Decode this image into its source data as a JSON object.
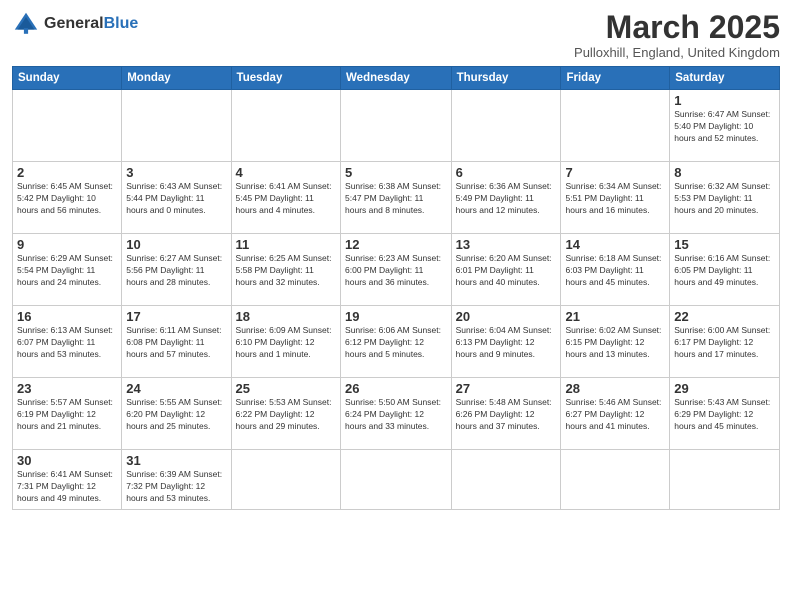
{
  "header": {
    "logo_general": "General",
    "logo_blue": "Blue",
    "month_title": "March 2025",
    "subtitle": "Pulloxhill, England, United Kingdom"
  },
  "days_of_week": [
    "Sunday",
    "Monday",
    "Tuesday",
    "Wednesday",
    "Thursday",
    "Friday",
    "Saturday"
  ],
  "weeks": [
    [
      {
        "day": "",
        "info": ""
      },
      {
        "day": "",
        "info": ""
      },
      {
        "day": "",
        "info": ""
      },
      {
        "day": "",
        "info": ""
      },
      {
        "day": "",
        "info": ""
      },
      {
        "day": "",
        "info": ""
      },
      {
        "day": "1",
        "info": "Sunrise: 6:47 AM\nSunset: 5:40 PM\nDaylight: 10 hours and 52 minutes."
      }
    ],
    [
      {
        "day": "2",
        "info": "Sunrise: 6:45 AM\nSunset: 5:42 PM\nDaylight: 10 hours and 56 minutes."
      },
      {
        "day": "3",
        "info": "Sunrise: 6:43 AM\nSunset: 5:44 PM\nDaylight: 11 hours and 0 minutes."
      },
      {
        "day": "4",
        "info": "Sunrise: 6:41 AM\nSunset: 5:45 PM\nDaylight: 11 hours and 4 minutes."
      },
      {
        "day": "5",
        "info": "Sunrise: 6:38 AM\nSunset: 5:47 PM\nDaylight: 11 hours and 8 minutes."
      },
      {
        "day": "6",
        "info": "Sunrise: 6:36 AM\nSunset: 5:49 PM\nDaylight: 11 hours and 12 minutes."
      },
      {
        "day": "7",
        "info": "Sunrise: 6:34 AM\nSunset: 5:51 PM\nDaylight: 11 hours and 16 minutes."
      },
      {
        "day": "8",
        "info": "Sunrise: 6:32 AM\nSunset: 5:53 PM\nDaylight: 11 hours and 20 minutes."
      }
    ],
    [
      {
        "day": "9",
        "info": "Sunrise: 6:29 AM\nSunset: 5:54 PM\nDaylight: 11 hours and 24 minutes."
      },
      {
        "day": "10",
        "info": "Sunrise: 6:27 AM\nSunset: 5:56 PM\nDaylight: 11 hours and 28 minutes."
      },
      {
        "day": "11",
        "info": "Sunrise: 6:25 AM\nSunset: 5:58 PM\nDaylight: 11 hours and 32 minutes."
      },
      {
        "day": "12",
        "info": "Sunrise: 6:23 AM\nSunset: 6:00 PM\nDaylight: 11 hours and 36 minutes."
      },
      {
        "day": "13",
        "info": "Sunrise: 6:20 AM\nSunset: 6:01 PM\nDaylight: 11 hours and 40 minutes."
      },
      {
        "day": "14",
        "info": "Sunrise: 6:18 AM\nSunset: 6:03 PM\nDaylight: 11 hours and 45 minutes."
      },
      {
        "day": "15",
        "info": "Sunrise: 6:16 AM\nSunset: 6:05 PM\nDaylight: 11 hours and 49 minutes."
      }
    ],
    [
      {
        "day": "16",
        "info": "Sunrise: 6:13 AM\nSunset: 6:07 PM\nDaylight: 11 hours and 53 minutes."
      },
      {
        "day": "17",
        "info": "Sunrise: 6:11 AM\nSunset: 6:08 PM\nDaylight: 11 hours and 57 minutes."
      },
      {
        "day": "18",
        "info": "Sunrise: 6:09 AM\nSunset: 6:10 PM\nDaylight: 12 hours and 1 minute."
      },
      {
        "day": "19",
        "info": "Sunrise: 6:06 AM\nSunset: 6:12 PM\nDaylight: 12 hours and 5 minutes."
      },
      {
        "day": "20",
        "info": "Sunrise: 6:04 AM\nSunset: 6:13 PM\nDaylight: 12 hours and 9 minutes."
      },
      {
        "day": "21",
        "info": "Sunrise: 6:02 AM\nSunset: 6:15 PM\nDaylight: 12 hours and 13 minutes."
      },
      {
        "day": "22",
        "info": "Sunrise: 6:00 AM\nSunset: 6:17 PM\nDaylight: 12 hours and 17 minutes."
      }
    ],
    [
      {
        "day": "23",
        "info": "Sunrise: 5:57 AM\nSunset: 6:19 PM\nDaylight: 12 hours and 21 minutes."
      },
      {
        "day": "24",
        "info": "Sunrise: 5:55 AM\nSunset: 6:20 PM\nDaylight: 12 hours and 25 minutes."
      },
      {
        "day": "25",
        "info": "Sunrise: 5:53 AM\nSunset: 6:22 PM\nDaylight: 12 hours and 29 minutes."
      },
      {
        "day": "26",
        "info": "Sunrise: 5:50 AM\nSunset: 6:24 PM\nDaylight: 12 hours and 33 minutes."
      },
      {
        "day": "27",
        "info": "Sunrise: 5:48 AM\nSunset: 6:26 PM\nDaylight: 12 hours and 37 minutes."
      },
      {
        "day": "28",
        "info": "Sunrise: 5:46 AM\nSunset: 6:27 PM\nDaylight: 12 hours and 41 minutes."
      },
      {
        "day": "29",
        "info": "Sunrise: 5:43 AM\nSunset: 6:29 PM\nDaylight: 12 hours and 45 minutes."
      }
    ],
    [
      {
        "day": "30",
        "info": "Sunrise: 6:41 AM\nSunset: 7:31 PM\nDaylight: 12 hours and 49 minutes."
      },
      {
        "day": "31",
        "info": "Sunrise: 6:39 AM\nSunset: 7:32 PM\nDaylight: 12 hours and 53 minutes."
      },
      {
        "day": "",
        "info": ""
      },
      {
        "day": "",
        "info": ""
      },
      {
        "day": "",
        "info": ""
      },
      {
        "day": "",
        "info": ""
      },
      {
        "day": "",
        "info": ""
      }
    ]
  ]
}
